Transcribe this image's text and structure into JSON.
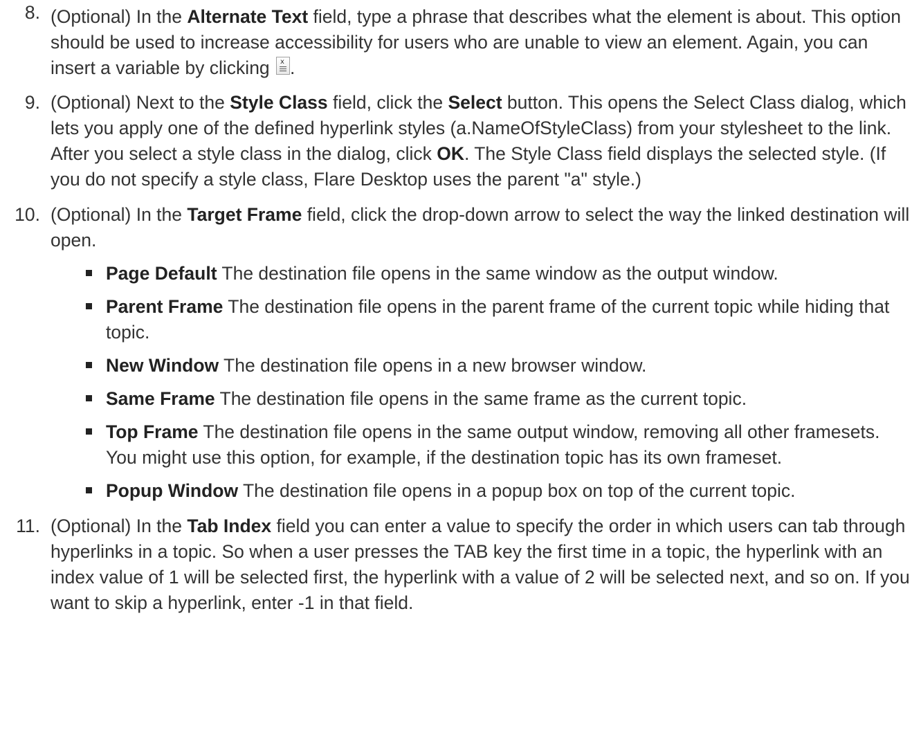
{
  "steps": {
    "s8": {
      "num": "8.",
      "t1": "(Optional) In the ",
      "b1": "Alternate Text",
      "t2": " field, type a phrase that describes what the element is about. This option should be used to increase accessibility for users who are unable to view an element. Again, you can insert a variable by clicking ",
      "t3": "."
    },
    "s9": {
      "num": "9.",
      "t1": "(Optional) Next to the ",
      "b1": "Style Class",
      "t2": " field, click the ",
      "b2": "Select",
      "t3": " button. This opens the Select Class dialog, which lets you apply one of the defined hyperlink styles (a.NameOfStyleClass) from your stylesheet to the link. After you select a style class in the dialog, click ",
      "b3": "OK",
      "t4": ". The Style Class field displays the selected style. (If you do not specify a style class, Flare Desktop uses the parent \"a\" style.)"
    },
    "s10": {
      "num": "10.",
      "t1": "(Optional) In the ",
      "b1": "Target Frame",
      "t2": " field, click the drop-down arrow to select the way the linked destination will open.",
      "bullets": [
        {
          "term": "Page Default",
          "desc": " The destination file opens in the same window as the output window."
        },
        {
          "term": "Parent Frame",
          "desc": " The destination file opens in the parent frame of the current topic while hiding that topic."
        },
        {
          "term": "New Window",
          "desc": " The destination file opens in a new browser window."
        },
        {
          "term": "Same Frame",
          "desc": " The destination file opens in the same frame as the current topic."
        },
        {
          "term": "Top Frame",
          "desc": " The destination file opens in the same output window, removing all other framesets. You might use this option, for example, if the destination topic has its own frameset."
        },
        {
          "term": "Popup Window",
          "desc": " The destination file opens in a popup box on top of the current topic."
        }
      ]
    },
    "s11": {
      "num": "11.",
      "t1": "(Optional) In the ",
      "b1": "Tab Index",
      "t2": " field you can enter a value to specify the order in which users can tab through hyperlinks in a topic. So when a user presses the TAB key the first time in a topic, the hyperlink with an index value of 1 will be selected first, the hyperlink with a value of 2 will be selected next, and so on. If you want to skip a hyperlink, enter -1 in that field."
    }
  },
  "icons": {
    "insert_variable": "insert-variable-icon"
  }
}
